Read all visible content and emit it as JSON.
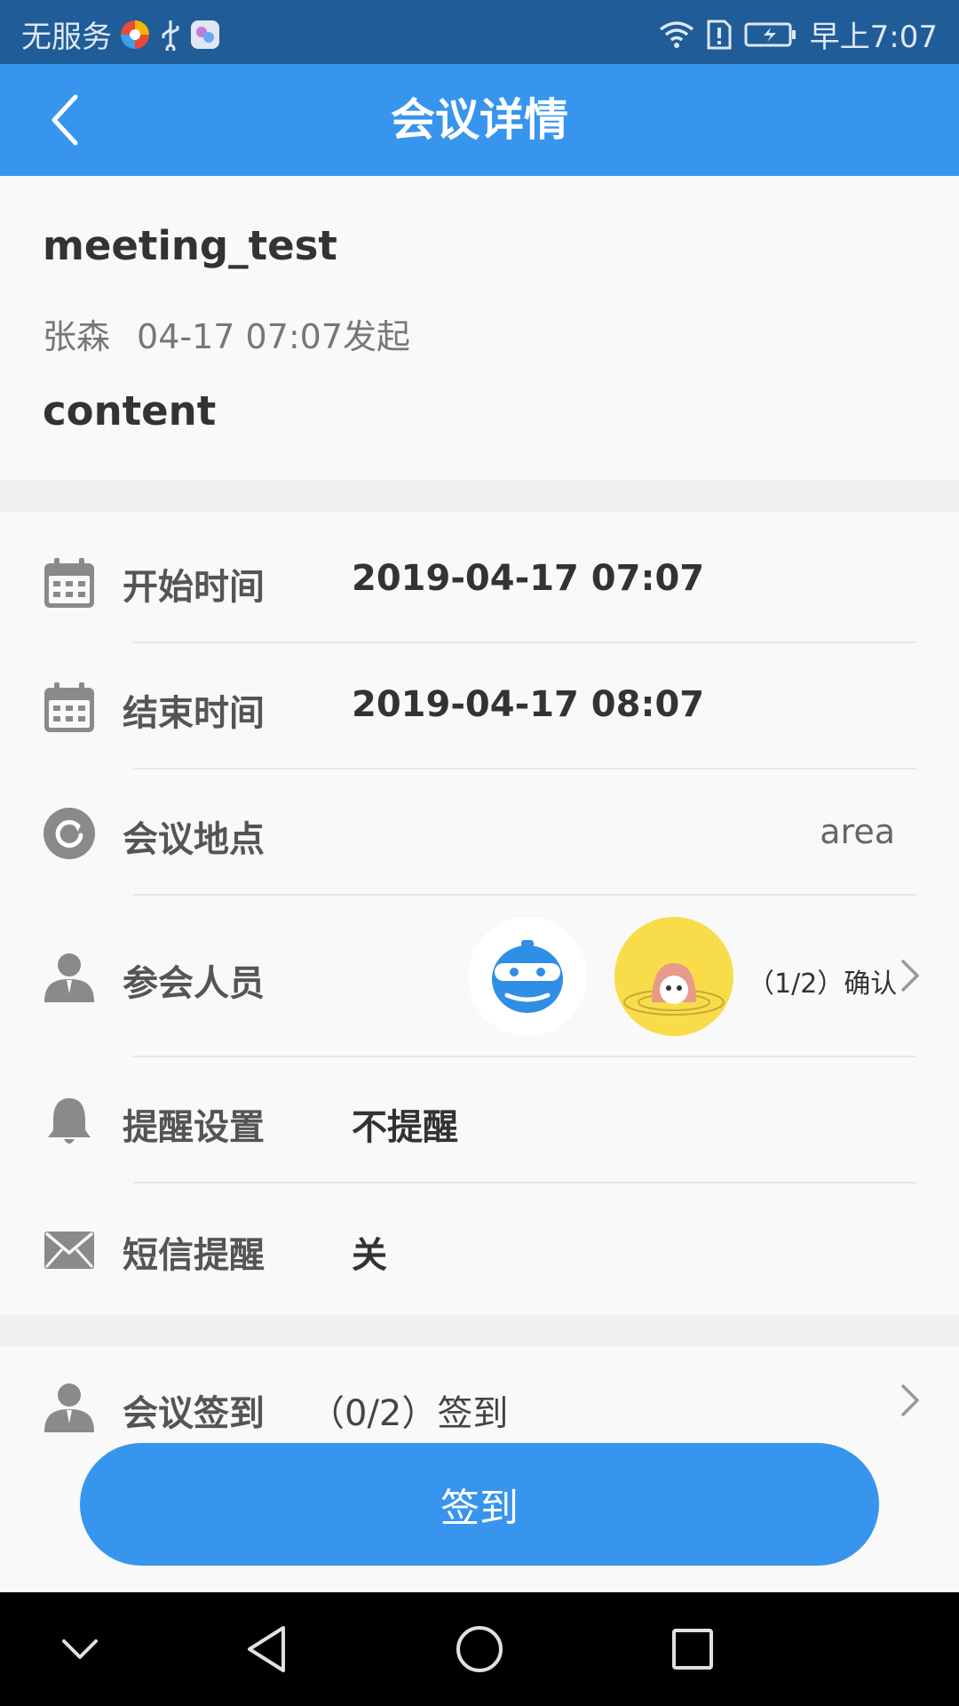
{
  "status_bar": {
    "carrier": "无服务",
    "time": "早上7:07"
  },
  "app_bar": {
    "title": "会议详情",
    "back_icon": "chevron-left-icon"
  },
  "meeting": {
    "title": "meeting_test",
    "organizer": "张森",
    "created": "04-17 07:07发起",
    "content": "content"
  },
  "details": [
    {
      "icon": "calendar-icon",
      "label": "开始时间",
      "value": "2019-04-17 07:07"
    },
    {
      "icon": "calendar-icon",
      "label": "结束时间",
      "value": "2019-04-17 08:07"
    },
    {
      "icon": "location-icon",
      "label": "会议地点",
      "value": "area"
    },
    {
      "icon": "person-icon",
      "label": "参会人员",
      "value": "（1/2）确认"
    },
    {
      "icon": "bell-icon",
      "label": "提醒设置",
      "value": "不提醒"
    },
    {
      "icon": "envelope-icon",
      "label": "短信提醒",
      "value": "关"
    }
  ],
  "signin_row": {
    "icon": "person-icon",
    "label": "会议签到",
    "value": "（0/2）签到"
  },
  "signin_button": "签到",
  "colors": {
    "accent": "#3795ee",
    "status_bar": "#1f5c98",
    "icon_gray": "#8a8a8a"
  }
}
